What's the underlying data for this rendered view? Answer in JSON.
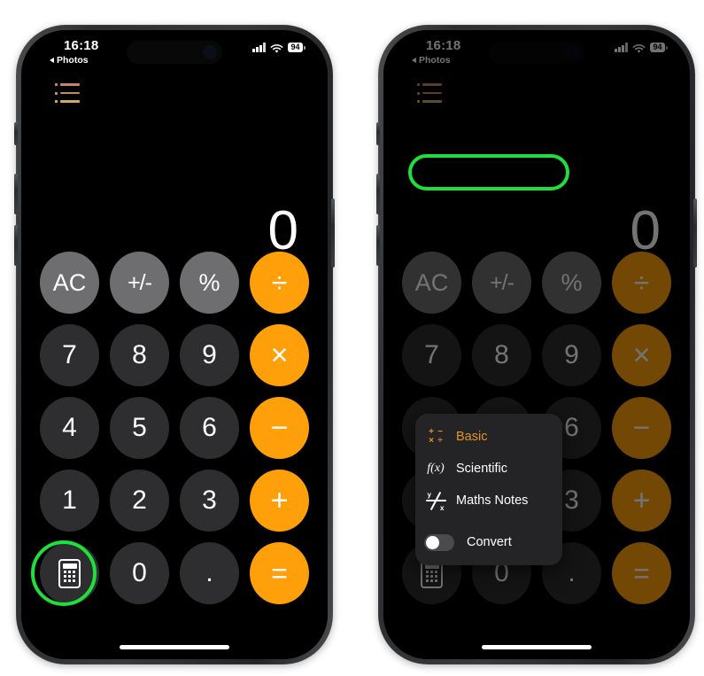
{
  "phones": [
    {
      "id": "phone-left",
      "label": "calculator-basic-screen",
      "status_bar": {
        "time": "16:18",
        "back_label": "Photos",
        "battery": "94",
        "cellular_icon": "cellular-signal-icon",
        "wifi_icon": "wifi-icon",
        "battery_icon": "battery-icon"
      },
      "menu_icon": "calculator-modes-list-icon",
      "display_value": "0",
      "keypad": [
        [
          {
            "label": "AC",
            "type": "fn",
            "name": "key-all-clear"
          },
          {
            "label": "+/-",
            "type": "fn",
            "name": "key-sign-toggle"
          },
          {
            "label": "%",
            "type": "fn",
            "name": "key-percent"
          },
          {
            "label": "÷",
            "type": "op",
            "name": "key-divide"
          }
        ],
        [
          {
            "label": "7",
            "type": "num",
            "name": "key-7"
          },
          {
            "label": "8",
            "type": "num",
            "name": "key-8"
          },
          {
            "label": "9",
            "type": "num",
            "name": "key-9"
          },
          {
            "label": "×",
            "type": "op",
            "name": "key-multiply"
          }
        ],
        [
          {
            "label": "4",
            "type": "num",
            "name": "key-4"
          },
          {
            "label": "5",
            "type": "num",
            "name": "key-5"
          },
          {
            "label": "6",
            "type": "num",
            "name": "key-6"
          },
          {
            "label": "−",
            "type": "op",
            "name": "key-minus"
          }
        ],
        [
          {
            "label": "1",
            "type": "num",
            "name": "key-1"
          },
          {
            "label": "2",
            "type": "num",
            "name": "key-2"
          },
          {
            "label": "3",
            "type": "num",
            "name": "key-3"
          },
          {
            "label": "+",
            "type": "op",
            "name": "key-plus"
          }
        ],
        [
          {
            "label": "",
            "type": "num",
            "name": "key-calculator-mode",
            "icon": "calculator-icon"
          },
          {
            "label": "0",
            "type": "num",
            "name": "key-0"
          },
          {
            "label": ".",
            "type": "num",
            "name": "key-decimal"
          },
          {
            "label": "=",
            "type": "op",
            "name": "key-equals"
          }
        ]
      ],
      "highlight": "calculator-mode-button"
    },
    {
      "id": "phone-right",
      "label": "calculator-mode-menu-open",
      "status_bar": {
        "time": "16:18",
        "back_label": "Photos",
        "battery": "94",
        "cellular_icon": "cellular-signal-icon",
        "wifi_icon": "wifi-icon",
        "battery_icon": "battery-icon"
      },
      "menu_icon": "calculator-modes-list-icon",
      "display_value": "0",
      "highlight": "maths-notes-menu-item"
    }
  ],
  "mode_menu": {
    "items": [
      {
        "label": "Basic",
        "icon": "basic-operations-icon",
        "active": true,
        "name": "menu-item-basic"
      },
      {
        "label": "Scientific",
        "icon": "function-fx-icon",
        "active": false,
        "name": "menu-item-scientific"
      },
      {
        "label": "Maths Notes",
        "icon": "maths-notes-icon",
        "active": false,
        "name": "menu-item-maths-notes"
      }
    ],
    "toggle": {
      "label": "Convert",
      "state": "off",
      "name": "menu-toggle-convert"
    },
    "basic_icon_glyphs": [
      "+",
      "−",
      "×",
      "÷"
    ],
    "fx_icon_text": "f(x)",
    "notes_icon_labels": {
      "y": "y",
      "x": "x"
    }
  },
  "colors": {
    "accent_orange": "#ff9f0a",
    "active_orange": "#e8932a",
    "highlight_green": "#1fe03a",
    "key_function_gray": "#6e6e70",
    "key_number_gray": "#2e2e30",
    "screen_black": "#000000",
    "menu_panel": "#242426",
    "page_background": "#ffffff"
  }
}
